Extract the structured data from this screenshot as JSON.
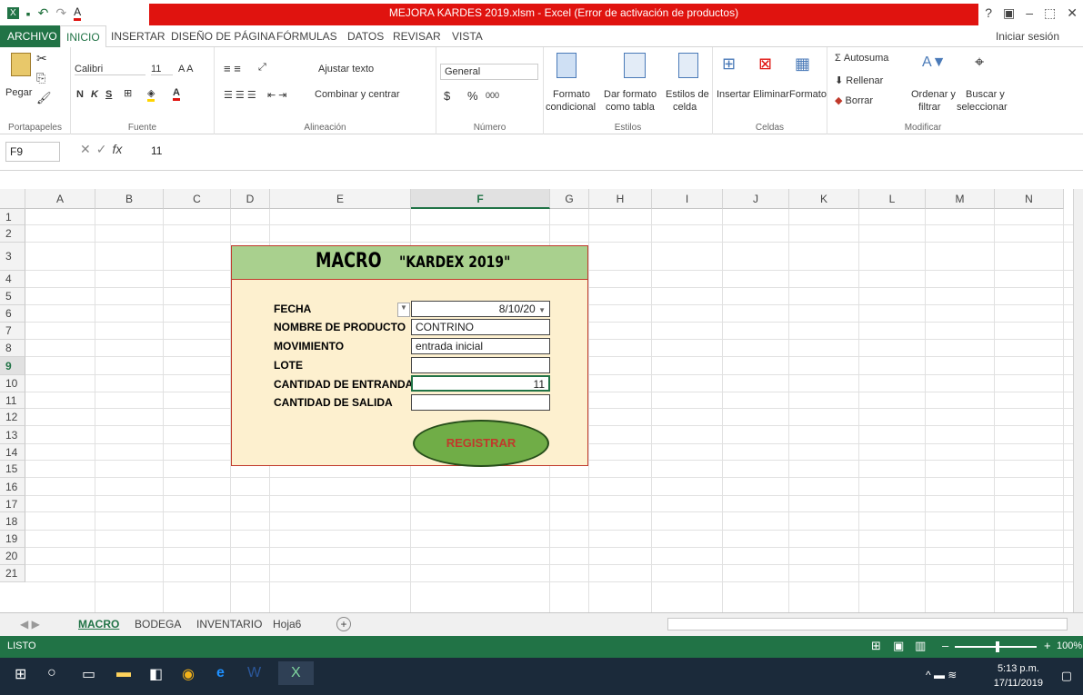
{
  "window": {
    "title": "MEJORA KARDES 2019.xlsm - Excel (Error de activación de productos)",
    "controls": [
      "?",
      "▣",
      "–",
      "⬚",
      "✕"
    ]
  },
  "ribbon_tabs": [
    "ARCHIVO",
    "INICIO",
    "INSERTAR",
    "DISEÑO DE PÁGINA",
    "FÓRMULAS",
    "DATOS",
    "REVISAR",
    "VISTA"
  ],
  "signin": "Iniciar sesión",
  "ribbon": {
    "clipboard": {
      "paste": "Pegar",
      "label": "Portapapeles"
    },
    "font": {
      "name": "Calibri",
      "size": "11",
      "bold": "N",
      "italic": "K",
      "underline": "S",
      "label": "Fuente"
    },
    "alignment": {
      "wrap": "Ajustar texto",
      "merge": "Combinar y centrar",
      "label": "Alineación"
    },
    "number": {
      "format": "General",
      "currency": "$",
      "percent": "%",
      "thousands": "000",
      "label": "Número"
    },
    "styles": {
      "conditional_1": "Formato",
      "conditional_2": "condicional",
      "table_1": "Dar formato",
      "table_2": "como tabla",
      "cell_1": "Estilos de",
      "cell_2": "celda",
      "label": "Estilos"
    },
    "cells": {
      "insert": "Insertar",
      "delete": "Eliminar",
      "format": "Formato",
      "label": "Celdas"
    },
    "editing": {
      "autosum": "Autosuma",
      "fill": "Rellenar",
      "clear": "Borrar",
      "sort_1": "Ordenar y",
      "sort_2": "filtrar",
      "find_1": "Buscar y",
      "find_2": "seleccionar",
      "label": "Modificar"
    }
  },
  "formula_bar": {
    "name_box": "F9",
    "fx": "fx",
    "value": "11"
  },
  "columns": [
    "A",
    "B",
    "C",
    "D",
    "E",
    "F",
    "G",
    "H",
    "I",
    "J",
    "K",
    "L",
    "M",
    "N"
  ],
  "rows": [
    "1",
    "2",
    "3",
    "4",
    "5",
    "6",
    "7",
    "8",
    "9",
    "10",
    "11",
    "12",
    "13",
    "14",
    "15",
    "16",
    "17",
    "18",
    "19",
    "20",
    "21"
  ],
  "selected_cell": {
    "column": "F",
    "row": "9"
  },
  "form": {
    "macro": "MACRO",
    "kardex": "\"KARDEX 2019\"",
    "fields": [
      {
        "label": "FECHA",
        "value": "8/10/20"
      },
      {
        "label": "NOMBRE DE PRODUCTO",
        "value": "CONTRINO"
      },
      {
        "label": "MOVIMIENTO",
        "value": "entrada inicial"
      },
      {
        "label": "LOTE",
        "value": ""
      },
      {
        "label": "CANTIDAD DE ENTRANDA",
        "value": "11"
      },
      {
        "label": "CANTIDAD DE SALIDA",
        "value": ""
      }
    ],
    "button": "REGISTRAR"
  },
  "sheet_tabs": [
    "MACRO",
    "BODEGA",
    "INVENTARIO",
    "Hoja6"
  ],
  "status": {
    "mode": "LISTO",
    "zoom": "100%"
  },
  "taskbar": {
    "time": "5:13 p.m.",
    "date": "17/11/2019"
  }
}
